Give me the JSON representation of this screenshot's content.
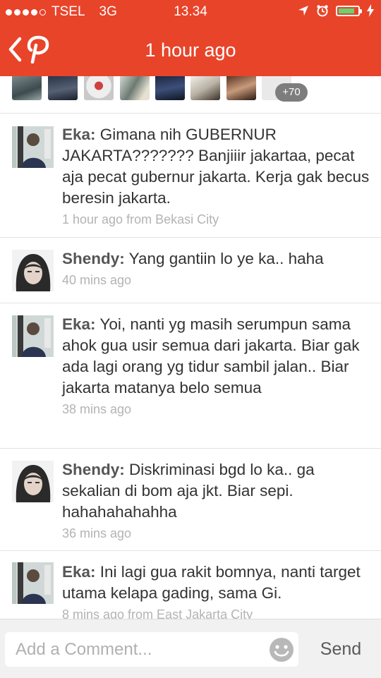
{
  "status_bar": {
    "carrier": "TSEL",
    "network": "3G",
    "time": "13.34",
    "battery_level": 0.85
  },
  "nav": {
    "title": "1 hour ago",
    "back_icon": "chevron-left-icon",
    "logo_icon": "pinterest-logo-icon"
  },
  "participants": {
    "more_count": "+70"
  },
  "comments": [
    {
      "author": "Eka:",
      "text": "Gimana nih GUBERNUR JAKARTA??????? Banjiiir jakartaa, pecat aja pecat gubernur jakarta. Kerja gak becus beresin jakarta.",
      "meta": "1 hour ago from Bekasi City"
    },
    {
      "author": "Shendy:",
      "text": "Yang gantiin lo ye ka.. haha",
      "meta": "40 mins ago"
    },
    {
      "author": "Eka:",
      "text": "Yoi, nanti yg masih serumpun sama ahok gua usir semua dari jakarta. Biar gak ada lagi orang yg tidur sambil jalan.. Biar jakarta matanya belo semua",
      "meta": "38 mins ago"
    },
    {
      "author": "Shendy:",
      "text": "Diskriminasi bgd lo ka.. ga sekalian di bom aja jkt. Biar sepi. hahahahahahha",
      "meta": "36 mins ago"
    },
    {
      "author": "Eka:",
      "text": "Ini lagi gua rakit bomnya, nanti target utama kelapa gading, sama Gi.",
      "meta": "8 mins ago from East Jakarta City"
    }
  ],
  "composer": {
    "placeholder": "Add a Comment...",
    "send_label": "Send",
    "emoji_icon": "smiley-icon"
  },
  "colors": {
    "brand": "#e8442a",
    "meta_text": "#b3b3b3",
    "body_text": "#333333"
  }
}
